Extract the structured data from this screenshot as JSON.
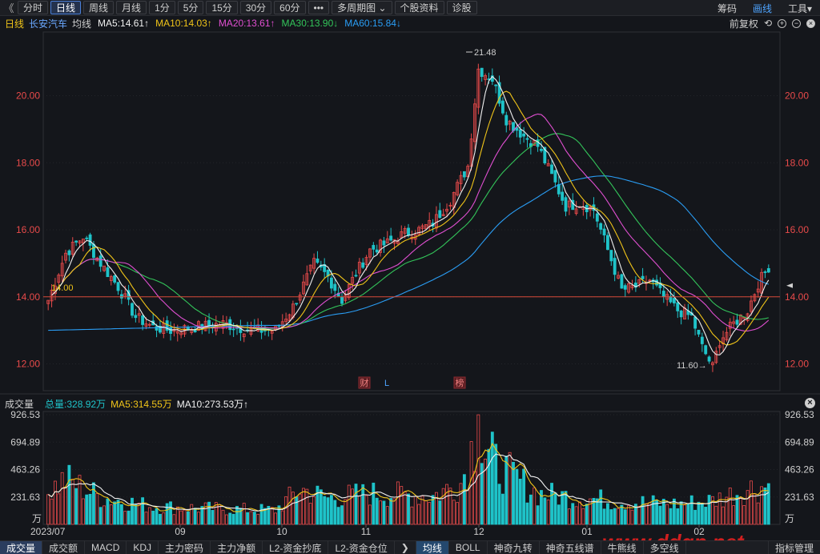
{
  "toolbar": {
    "back": "《",
    "buttons": [
      "分时",
      "日线",
      "周线",
      "月线",
      "1分",
      "5分",
      "15分",
      "30分",
      "60分",
      "•••",
      "多周期图 ⌄",
      "个股资料",
      "诊股"
    ],
    "active_index": 1,
    "right": {
      "chips": "筹码",
      "draw": "画线",
      "tools": "工具▾"
    }
  },
  "ma_bar": {
    "period": "日线",
    "stock": "长安汽车",
    "avg": "均线",
    "items": [
      {
        "label": "MA5:14.61↑",
        "color": "#f0f0f0"
      },
      {
        "label": "MA10:14.03↑",
        "color": "#f0c419"
      },
      {
        "label": "MA20:13.61↑",
        "color": "#e04fd1"
      },
      {
        "label": "MA30:13.90↓",
        "color": "#33c55a"
      },
      {
        "label": "MA60:15.84↓",
        "color": "#2a9df4"
      }
    ],
    "right_label": "前复权"
  },
  "price_axis": {
    "min": 11.2,
    "max": 21.9,
    "ticks": [
      "20.00",
      "18.00",
      "16.00",
      "14.00",
      "12.00"
    ],
    "tick_values": [
      20,
      18,
      16,
      14,
      12
    ]
  },
  "annotations": {
    "high": "21.48",
    "low": "11.60→",
    "ref_line_value": "14.00",
    "markers": [
      {
        "label": "财"
      },
      {
        "label": "L"
      },
      {
        "label": "榜"
      }
    ]
  },
  "volume_bar": {
    "title": "成交量",
    "total": "总量:328.92万",
    "ma5": "MA5:314.55万",
    "ma10": "MA10:273.53万↑"
  },
  "volume_axis": {
    "max": 926.53,
    "ticks": [
      "926.53",
      "694.89",
      "463.26",
      "231.63",
      "万"
    ],
    "tick_values": [
      926.53,
      694.89,
      463.26,
      231.63
    ]
  },
  "date_axis": [
    "2023/07",
    "09",
    "10",
    "11",
    "12",
    "01",
    "02"
  ],
  "bottom_tabs": {
    "left": [
      "成交量",
      "成交额",
      "MACD",
      "KDJ",
      "主力密码",
      "主力净额",
      "L2-资金抄底",
      "L2-资金仓位"
    ],
    "arrow": "❯",
    "right": [
      "均线",
      "BOLL",
      "神奇九转",
      "神奇五线谱",
      "牛熊线",
      "多空线"
    ],
    "last": "指标管理"
  },
  "watermark": "www.ddgp.net",
  "colors": {
    "up": "#e84a4a",
    "down": "#1fc3c9",
    "ma5": "#f0f0f0",
    "ma10": "#f0c419",
    "ma20": "#e04fd1",
    "ma30": "#33c55a",
    "ma60": "#2a9df4",
    "ref": "#d84a3a"
  }
}
